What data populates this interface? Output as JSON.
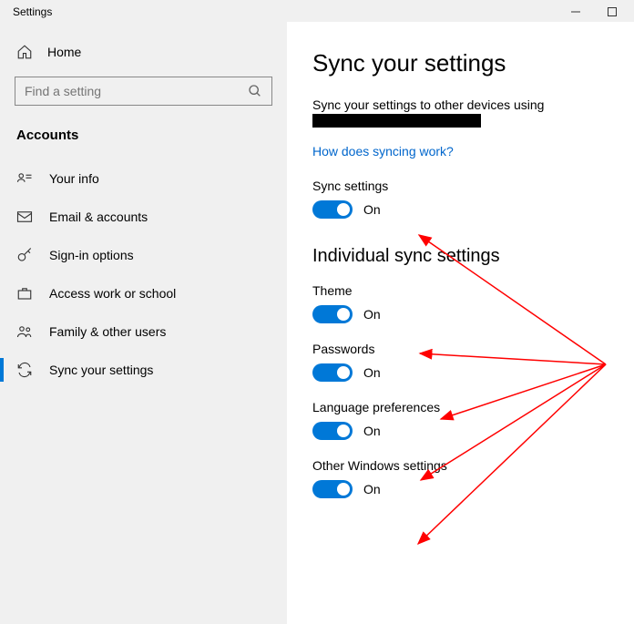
{
  "window": {
    "title": "Settings"
  },
  "sidebar": {
    "home_label": "Home",
    "search_placeholder": "Find a setting",
    "heading": "Accounts",
    "items": [
      {
        "label": "Your info"
      },
      {
        "label": "Email & accounts"
      },
      {
        "label": "Sign-in options"
      },
      {
        "label": "Access work or school"
      },
      {
        "label": "Family & other users"
      },
      {
        "label": "Sync your settings"
      }
    ]
  },
  "content": {
    "title": "Sync your settings",
    "description": "Sync your settings to other devices using",
    "link": "How does syncing work?",
    "sync_label": "Sync settings",
    "on_text": "On",
    "subheading": "Individual sync settings",
    "toggles": [
      {
        "label": "Theme"
      },
      {
        "label": "Passwords"
      },
      {
        "label": "Language preferences"
      },
      {
        "label": "Other Windows settings"
      }
    ]
  }
}
